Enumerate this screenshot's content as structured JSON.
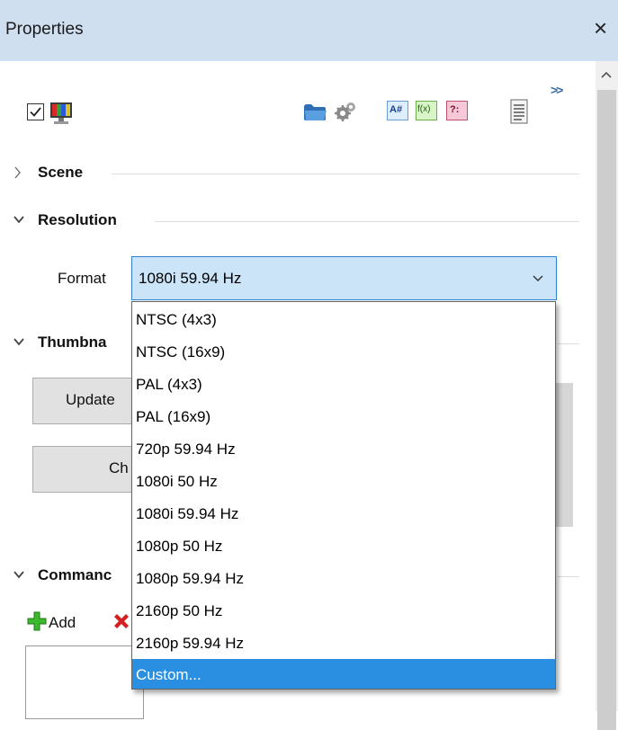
{
  "window": {
    "title": "Properties",
    "close_glyph": "×"
  },
  "toolbar": {
    "checkbox_checked": true,
    "icons": [
      "monitor-icon",
      "folder-icon",
      "gears-icon",
      "font-a-icon",
      "fx-icon",
      "ternary-icon",
      "document-icon"
    ],
    "font_icon_label": "A#",
    "fx_icon_label": "f(x)",
    "ternary_icon_label": "?:",
    "expand_label": ">>"
  },
  "sections": {
    "scene": {
      "title": "Scene",
      "expanded": false
    },
    "resolution": {
      "title": "Resolution",
      "expanded": true
    },
    "thumbnail": {
      "title": "Thumbna"
    },
    "commands": {
      "title": "Commanc"
    }
  },
  "resolution": {
    "format_label": "Format",
    "format_value": "1080i 59.94 Hz",
    "options": [
      "NTSC (4x3)",
      "NTSC (16x9)",
      "PAL (4x3)",
      "PAL (16x9)",
      "720p 59.94 Hz",
      "1080i 50 Hz",
      "1080i 59.94 Hz",
      "1080p 50 Hz",
      "1080p 59.94 Hz",
      "2160p 50 Hz",
      "2160p 59.94 Hz",
      "Custom..."
    ],
    "highlighted_option": "Custom..."
  },
  "thumbnail": {
    "update_button_label": "Update",
    "change_button_label": "Ch"
  },
  "commands": {
    "add_label": "Add"
  },
  "colors": {
    "titlebar": "#cfdff0",
    "combo_bg": "#cce4f7",
    "combo_border": "#2f80d0",
    "highlight": "#2a8fe0"
  }
}
